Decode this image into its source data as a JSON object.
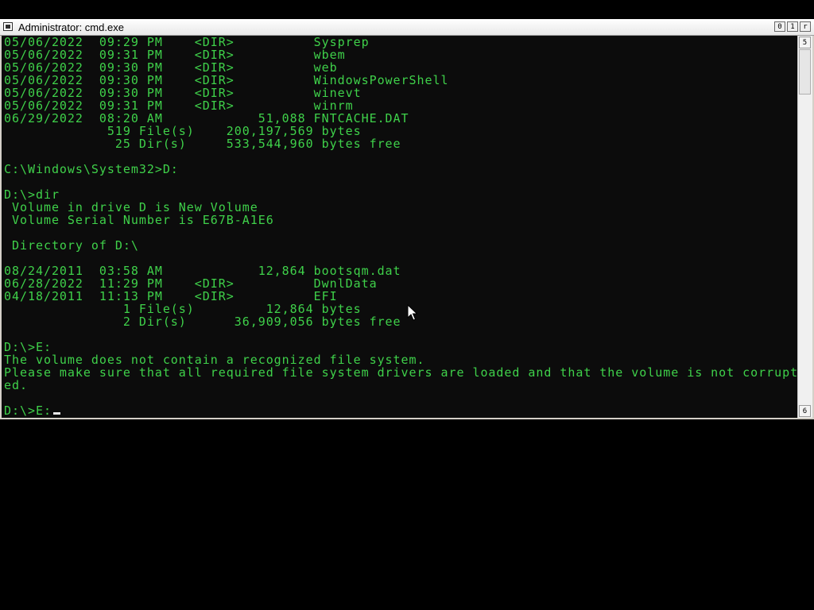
{
  "window": {
    "title": "Administrator: cmd.exe"
  },
  "caption_buttons": {
    "minimize": "0",
    "maximize": "1",
    "close": "r"
  },
  "scrollbar": {
    "up_arrow": "5",
    "down_arrow": "6"
  },
  "console_lines": [
    "05/06/2022  09:29 PM    <DIR>          Sysprep",
    "05/06/2022  09:31 PM    <DIR>          wbem",
    "05/06/2022  09:30 PM    <DIR>          web",
    "05/06/2022  09:30 PM    <DIR>          WindowsPowerShell",
    "05/06/2022  09:30 PM    <DIR>          winevt",
    "05/06/2022  09:31 PM    <DIR>          winrm",
    "06/29/2022  08:20 AM            51,088 FNTCACHE.DAT",
    "             519 File(s)    200,197,569 bytes",
    "              25 Dir(s)     533,544,960 bytes free",
    "",
    "C:\\Windows\\System32>D:",
    "",
    "D:\\>dir",
    " Volume in drive D is New Volume",
    " Volume Serial Number is E67B-A1E6",
    "",
    " Directory of D:\\",
    "",
    "08/24/2011  03:58 AM            12,864 bootsqm.dat",
    "06/28/2022  11:29 PM    <DIR>          DwnlData",
    "04/18/2011  11:13 PM    <DIR>          EFI",
    "               1 File(s)         12,864 bytes",
    "               2 Dir(s)      36,909,056 bytes free",
    "",
    "D:\\>E:",
    "The volume does not contain a recognized file system.",
    "Please make sure that all required file system drivers are loaded and that the volume is not corrupt",
    "ed.",
    ""
  ],
  "prompt": "D:\\>E:",
  "colors": {
    "console_background": "#0c0c0c",
    "console_text": "#3fd14a",
    "desktop_background": "#000000"
  }
}
